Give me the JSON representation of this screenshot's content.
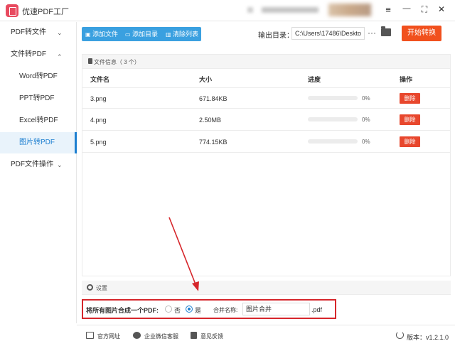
{
  "app": {
    "title": "优速PDF工厂"
  },
  "window": {
    "menu_icon": "≡",
    "minimize_icon": "—",
    "fullscreen_icon": "⛶",
    "close_icon": "✕"
  },
  "sidebar": {
    "items": [
      {
        "label": "PDF转文件",
        "chevron": "⌄"
      },
      {
        "label": "文件转PDF",
        "chevron": "⌃"
      },
      {
        "label": "Word转PDF"
      },
      {
        "label": "PPT转PDF"
      },
      {
        "label": "Excel转PDF"
      },
      {
        "label": "图片转PDF",
        "active": true
      },
      {
        "label": "PDF文件操作",
        "chevron": "⌄"
      }
    ]
  },
  "toolbar": {
    "add_file": "添加文件",
    "add_folder": "添加目录",
    "clear_list": "清除列表",
    "output_label": "输出目录：",
    "output_path": "C:\\Users\\17486\\Deskto",
    "more": "···",
    "start": "开始转换"
  },
  "files": {
    "title": "文件信息（ 3 个）",
    "columns": {
      "name": "文件名",
      "size": "大小",
      "progress": "进度",
      "action": "操作"
    },
    "rows": [
      {
        "name": "3.png",
        "size": "671.84KB",
        "progress": 0,
        "progress_text": "0%",
        "delete": "删除"
      },
      {
        "name": "4.png",
        "size": "2.50MB",
        "progress": 0,
        "progress_text": "0%",
        "delete": "删除"
      },
      {
        "name": "5.png",
        "size": "774.15KB",
        "progress": 0,
        "progress_text": "0%",
        "delete": "删除"
      }
    ]
  },
  "settings": {
    "title": "设置",
    "merge_label": "将所有图片合成一个PDF:",
    "option_no": "否",
    "option_yes": "是",
    "selected": "是",
    "name_label": "合并名称:",
    "name_value": "图片合并",
    "ext": ".pdf"
  },
  "footer": {
    "website": "官方网址",
    "wechat": "企业微信客服",
    "feedback": "意见反馈",
    "version": "版本：v1.2.1.0"
  },
  "colors": {
    "accent": "#3aa0e0",
    "start": "#f1501d",
    "delete": "#e8472d",
    "annotation": "#d6262b"
  }
}
